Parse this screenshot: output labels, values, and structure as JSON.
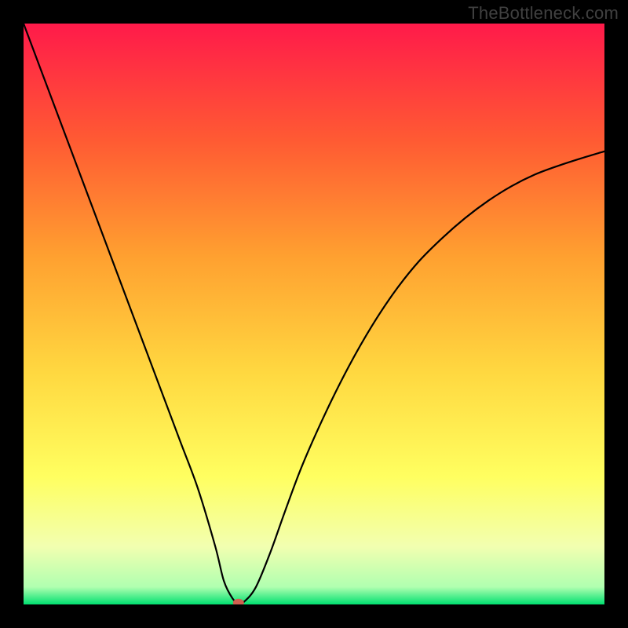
{
  "watermark": "TheBottleneck.com",
  "chart_data": {
    "type": "line",
    "title": "",
    "xlabel": "",
    "ylabel": "",
    "xlim": [
      0,
      100
    ],
    "ylim": [
      0,
      100
    ],
    "gradient_stops": [
      {
        "offset": 0,
        "color": "#ff1a4a"
      },
      {
        "offset": 20,
        "color": "#ff5a33"
      },
      {
        "offset": 40,
        "color": "#ffa030"
      },
      {
        "offset": 60,
        "color": "#ffd840"
      },
      {
        "offset": 78,
        "color": "#ffff60"
      },
      {
        "offset": 90,
        "color": "#f2ffb0"
      },
      {
        "offset": 97,
        "color": "#b0ffb0"
      },
      {
        "offset": 100,
        "color": "#00e070"
      }
    ],
    "series": [
      {
        "name": "bottleneck-curve",
        "x": [
          0,
          3,
          6,
          9,
          12,
          15,
          18,
          21,
          24,
          27,
          30,
          33,
          34.5,
          36,
          37,
          38,
          40,
          42.5,
          45,
          48,
          52,
          56,
          60,
          64,
          68,
          72,
          76,
          80,
          84,
          88,
          92,
          96,
          100
        ],
        "y": [
          100,
          92,
          84,
          76,
          68,
          60,
          52,
          44,
          36,
          28,
          20,
          10,
          4,
          1,
          0.3,
          0.5,
          3,
          9,
          16,
          24,
          33,
          41,
          48,
          54,
          59,
          63,
          66.5,
          69.5,
          72,
          74,
          75.5,
          76.8,
          78
        ]
      }
    ],
    "marker": {
      "name": "optimal-point",
      "x": 37,
      "y": 0.3,
      "color": "#d06050"
    }
  }
}
